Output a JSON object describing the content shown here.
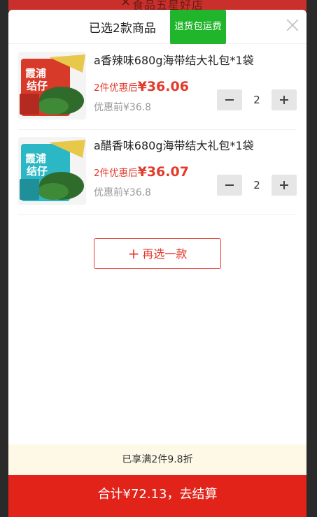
{
  "background": {
    "text": " 食品五星好店 ",
    "close_glyph": "×"
  },
  "header": {
    "title": "已选2款商品",
    "badge": "退货包运费"
  },
  "items": [
    {
      "name": "a香辣味680g海带结大礼包*1袋",
      "price_label": "2件优惠后",
      "price_value": "¥36.06",
      "original_price": "优惠前¥36.8",
      "quantity": "2",
      "thumb_color": "#d83a2a",
      "thumb_text": "霞浦\n结仔"
    },
    {
      "name": "a醋香味680g海带结大礼包*1袋",
      "price_label": "2件优惠后",
      "price_value": "¥36.07",
      "original_price": "优惠前¥36.8",
      "quantity": "2",
      "thumb_color": "#2bb7c4",
      "thumb_text": "霞浦\n结仔"
    }
  ],
  "add_more": {
    "plus": "+",
    "label": "再选一款"
  },
  "discount_bar": "已享满2件9.8折",
  "checkout": "合计¥72.13，去结算",
  "colors": {
    "accent": "#e2231a",
    "badge": "#21b52b",
    "discount_bg": "#fdf9e6"
  }
}
